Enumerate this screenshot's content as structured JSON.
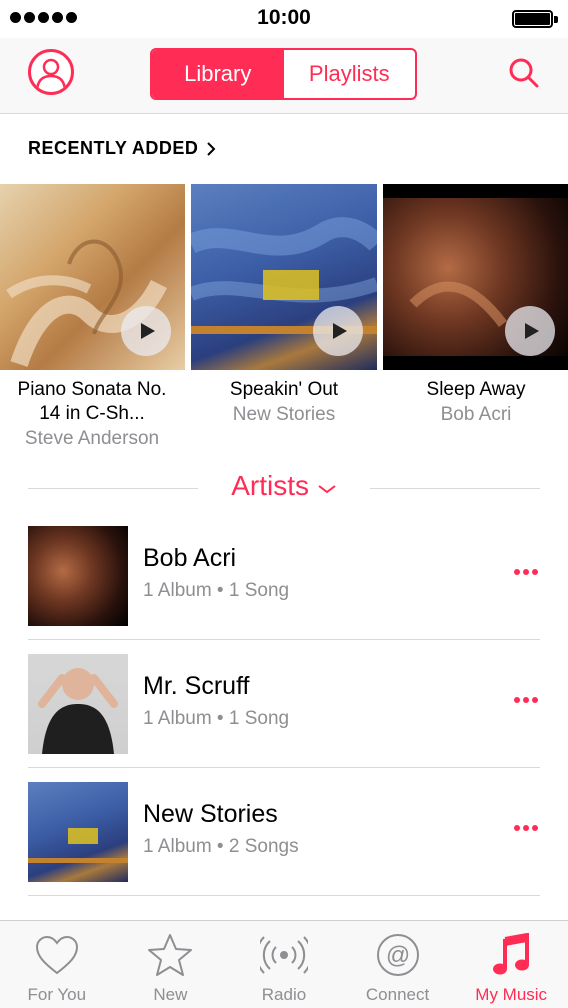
{
  "status_bar": {
    "time": "10:00",
    "signal_dots": 5
  },
  "header": {
    "profile_icon": "person-circle-icon",
    "segments": [
      {
        "label": "Library",
        "active": true
      },
      {
        "label": "Playlists",
        "active": false
      }
    ],
    "search_icon": "search-icon"
  },
  "recently_added": {
    "title": "RECENTLY ADDED",
    "albums": [
      {
        "title": "Piano Sonata No. 14 in C-Sh...",
        "artist": "Steve Anderson"
      },
      {
        "title": "Speakin' Out",
        "artist": "New Stories"
      },
      {
        "title": "Sleep Away",
        "artist": "Bob Acri"
      }
    ]
  },
  "artists": {
    "label": "Artists",
    "items": [
      {
        "name": "Bob Acri",
        "meta": "1 Album • 1 Song"
      },
      {
        "name": "Mr. Scruff",
        "meta": "1 Album • 1 Song"
      },
      {
        "name": "New Stories",
        "meta": "1 Album • 2 Songs"
      }
    ]
  },
  "tab_bar": {
    "tabs": [
      {
        "label": "For You",
        "icon": "heart-icon",
        "active": false
      },
      {
        "label": "New",
        "icon": "star-icon",
        "active": false
      },
      {
        "label": "Radio",
        "icon": "radio-broadcast-icon",
        "active": false
      },
      {
        "label": "Connect",
        "icon": "at-sign-icon",
        "active": false
      },
      {
        "label": "My Music",
        "icon": "music-note-icon",
        "active": true
      }
    ]
  },
  "colors": {
    "accent": "#ff2d55",
    "secondary_text": "#8e8e93",
    "separator": "#d9d9d9"
  }
}
